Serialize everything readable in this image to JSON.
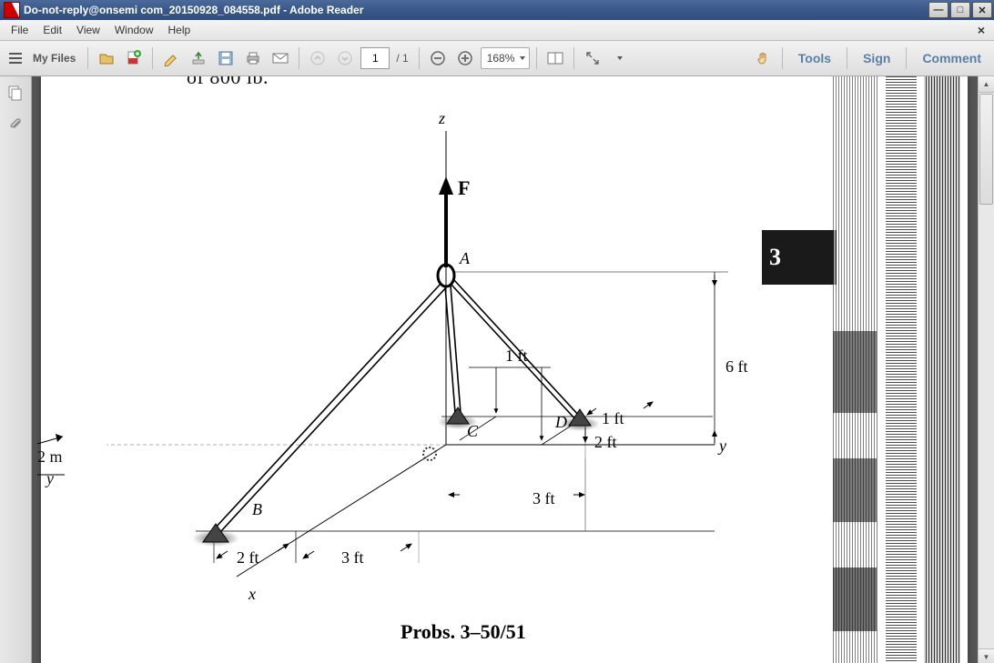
{
  "window": {
    "title": "Do-not-reply@onsemi com_20150928_084558.pdf - Adobe Reader"
  },
  "menubar": {
    "file": "File",
    "edit": "Edit",
    "view": "View",
    "window": "Window",
    "help": "Help"
  },
  "toolbar": {
    "my_files": "My Files",
    "page_current": "1",
    "page_total": "/ 1",
    "zoom": "168%",
    "tools": "Tools",
    "sign": "Sign",
    "comment": "Comment"
  },
  "document": {
    "partial_top_text": "of 800 lb.",
    "caption": "Probs. 3–50/51",
    "side_badge": "3",
    "labels": {
      "z": "z",
      "F": "F",
      "A": "A",
      "B": "B",
      "C": "C",
      "D": "D",
      "x": "x",
      "y": "y",
      "y_left": "y",
      "m_left": "2 m",
      "one_ft": "1 ft",
      "one_ft_b": "1 ft",
      "two_ft_a": "2 ft",
      "two_ft_b": "2 ft",
      "three_ft_a": "3 ft",
      "three_ft_b": "3 ft",
      "six_ft": "6 ft"
    }
  }
}
